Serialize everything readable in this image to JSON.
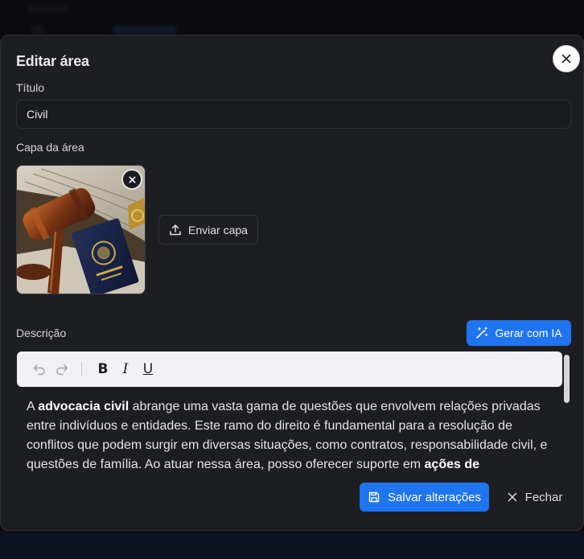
{
  "modal": {
    "title": "Editar área"
  },
  "title_field": {
    "label": "Título",
    "value": "Civil"
  },
  "cover": {
    "label": "Capa da área",
    "upload_label": "Enviar capa",
    "image_subject": "gavel-and-passport-photo"
  },
  "description": {
    "label": "Descrição",
    "ai_button_label": "Gerar com IA",
    "toolbar": {
      "undo_icon": "undo-icon",
      "redo_icon": "redo-icon",
      "bold_glyph": "B",
      "italic_glyph": "I",
      "underline_glyph": "U"
    },
    "segments": [
      {
        "text": "A ",
        "bold": false
      },
      {
        "text": "advocacia civil",
        "bold": true
      },
      {
        "text": " abrange uma vasta gama de questões que envolvem relações privadas entre indivíduos e entidades. Este ramo do direito é fundamental para a resolução de conflitos que podem surgir em diversas situações, como contratos, responsabilidade civil, e questões de família. Ao atuar nessa área, posso oferecer suporte em ",
        "bold": false
      },
      {
        "text": "ações de",
        "bold": true
      }
    ]
  },
  "footer": {
    "save_label": "Salvar alterações",
    "close_label": "Fechar"
  },
  "colors": {
    "accent": "#1f74ef",
    "modal_bg": "#1d1e22",
    "page_bg": "#0b0b0d",
    "toolbar_bg": "#f1f1f3"
  }
}
